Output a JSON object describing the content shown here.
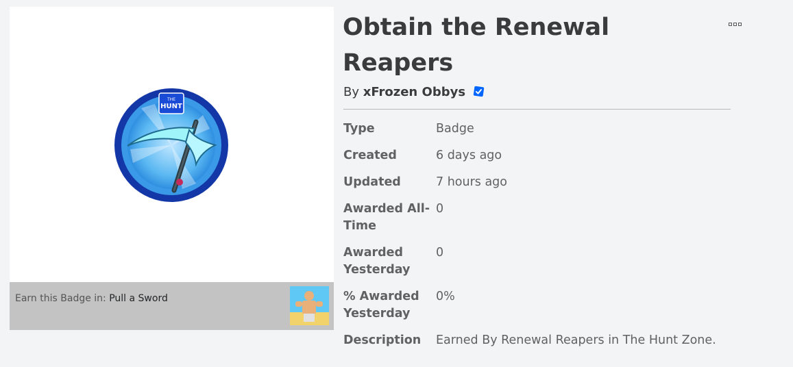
{
  "item": {
    "title": "Obtain the Renewal Reapers",
    "creator_prefix": "By",
    "creator_name": "xFrozen Obbys",
    "badge_icon": "badge-icon-the-hunt-scythe",
    "verified_icon": "verified-badge-icon",
    "more_icon": "more-options-icon"
  },
  "earn": {
    "prefix": "Earn this Badge in:",
    "game_name": "Pull a Sword",
    "thumbnail_icon": "game-thumbnail"
  },
  "details": {
    "type_label": "Type",
    "type_value": "Badge",
    "created_label": "Created",
    "created_value": "6 days ago",
    "updated_label": "Updated",
    "updated_value": "7 hours ago",
    "awarded_all_time_label": "Awarded All-Time",
    "awarded_all_time_value": "0",
    "awarded_yesterday_label": "Awarded Yesterday",
    "awarded_yesterday_value": "0",
    "percent_awarded_label": "% Awarded Yesterday",
    "percent_awarded_value": "0%",
    "description_label": "Description",
    "description_value": "Earned By Renewal Reapers in The Hunt Zone."
  },
  "colors": {
    "page_bg": "#f2f4f5",
    "verified": "#0066ff",
    "earn_bar": "#c3c3c3"
  }
}
